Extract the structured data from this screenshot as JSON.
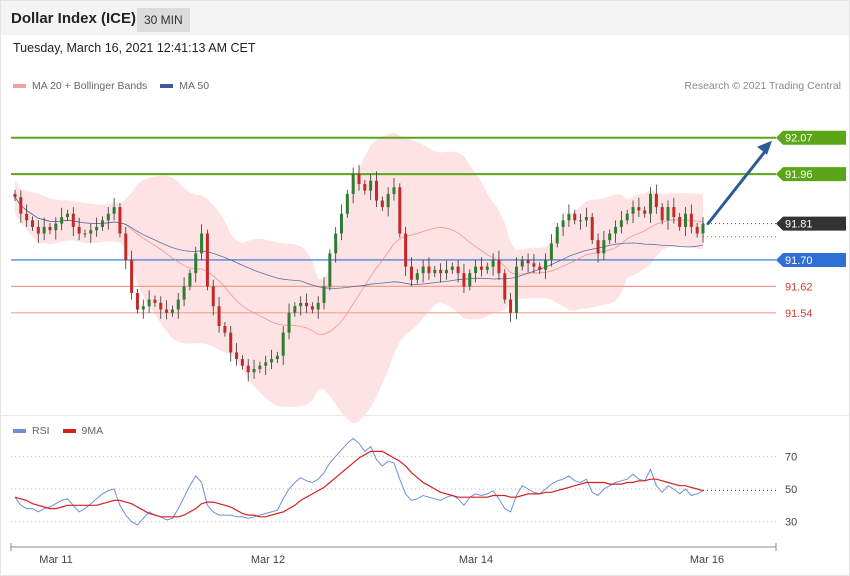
{
  "header": {
    "title": "Dollar Index (ICE)",
    "timeframe": "30 MIN",
    "datetime": "Tuesday, March 16, 2021 12:41:13 AM CET"
  },
  "colors": {
    "bollinger_fill": "#fde3e3",
    "ma20": "#f08080",
    "ma50": "#3d5a99",
    "resistance": "#5aa617",
    "support": "#f0a090",
    "pivot": "#2f6fd6",
    "current": "#333333",
    "arrow": "#2e5b97",
    "candle_up": "#2e7d32",
    "candle_down": "#c62828",
    "rsi": "#6f8fd8",
    "rsi_ma": "#d62020"
  },
  "legend": {
    "ma20": "MA 20 + Bollinger Bands",
    "ma50": "MA 50",
    "copyright": "Research © 2021 Trading Central"
  },
  "rsi_legend": {
    "rsi": "RSI",
    "ma": "9MA"
  },
  "chart_data": [
    {
      "type": "line",
      "chart": "price",
      "ylim": [
        91.27,
        92.16
      ],
      "x_ticks": [
        "Mar 11",
        "Mar 12",
        "Mar 14",
        "Mar 16"
      ],
      "levels": [
        {
          "value": 92.07,
          "label": "92.07",
          "kind": "resistance"
        },
        {
          "value": 91.96,
          "label": "91.96",
          "kind": "resistance"
        },
        {
          "value": 91.81,
          "label": "91.81",
          "kind": "current"
        },
        {
          "value": 91.7,
          "label": "91.70",
          "kind": "pivot"
        },
        {
          "value": 91.62,
          "label": "91.62",
          "kind": "support"
        },
        {
          "value": 91.54,
          "label": "91.54",
          "kind": "support"
        }
      ],
      "forecast_arrow": {
        "from": 91.81,
        "to": 92.07,
        "direction": "up"
      },
      "closes": [
        91.89,
        91.84,
        91.82,
        91.8,
        91.78,
        91.8,
        91.79,
        91.81,
        91.83,
        91.84,
        91.8,
        91.78,
        91.78,
        91.79,
        91.8,
        91.82,
        91.84,
        91.86,
        91.78,
        91.7,
        91.6,
        91.55,
        91.56,
        91.58,
        91.57,
        91.55,
        91.54,
        91.55,
        91.58,
        91.62,
        91.66,
        91.72,
        91.78,
        91.62,
        91.56,
        91.5,
        91.48,
        91.42,
        91.4,
        91.38,
        91.36,
        91.37,
        91.38,
        91.39,
        91.4,
        91.41,
        91.48,
        91.54,
        91.56,
        91.57,
        91.56,
        91.55,
        91.57,
        91.62,
        91.72,
        91.78,
        91.84,
        91.9,
        91.96,
        91.93,
        91.91,
        91.94,
        91.88,
        91.86,
        91.9,
        91.92,
        91.78,
        91.68,
        91.64,
        91.66,
        91.68,
        91.66,
        91.67,
        91.66,
        91.67,
        91.68,
        91.66,
        91.62,
        91.66,
        91.68,
        91.67,
        91.68,
        91.7,
        91.66,
        91.58,
        91.54,
        91.68,
        91.7,
        91.69,
        91.68,
        91.67,
        91.7,
        91.75,
        91.8,
        91.82,
        91.84,
        91.82,
        91.82,
        91.83,
        91.76,
        91.72,
        91.76,
        91.78,
        91.8,
        91.82,
        91.84,
        91.86,
        91.85,
        91.84,
        91.9,
        91.86,
        91.82,
        91.86,
        91.83,
        91.8,
        91.84,
        91.8,
        91.78,
        91.81
      ]
    },
    {
      "type": "line",
      "chart": "rsi",
      "ylim": [
        20,
        80
      ],
      "y_ticks": [
        30,
        50,
        70
      ],
      "series": [
        {
          "name": "RSI",
          "values": [
            45,
            40,
            38,
            38,
            36,
            38,
            39,
            41,
            43,
            44,
            40,
            36,
            38,
            41,
            44,
            47,
            49,
            50,
            40,
            34,
            30,
            28,
            32,
            36,
            34,
            33,
            31,
            32,
            38,
            45,
            52,
            58,
            54,
            40,
            36,
            34,
            34,
            34,
            33,
            33,
            32,
            33,
            34,
            35,
            36,
            37,
            44,
            50,
            54,
            57,
            55,
            54,
            56,
            60,
            66,
            70,
            74,
            78,
            81,
            78,
            73,
            76,
            68,
            64,
            67,
            66,
            56,
            47,
            43,
            44,
            46,
            45,
            44,
            43,
            45,
            46,
            44,
            40,
            45,
            47,
            46,
            47,
            49,
            44,
            38,
            36,
            46,
            52,
            50,
            48,
            47,
            50,
            53,
            55,
            56,
            58,
            55,
            54,
            56,
            48,
            46,
            50,
            52,
            54,
            55,
            56,
            59,
            56,
            55,
            62,
            52,
            48,
            52,
            50,
            47,
            50,
            46,
            47,
            49
          ]
        },
        {
          "name": "9MA",
          "values": [
            45,
            44,
            43,
            41,
            40,
            39,
            38,
            38,
            39,
            40,
            40,
            40,
            40,
            40,
            40,
            41,
            42,
            43,
            43,
            42,
            41,
            39,
            37,
            35,
            34,
            33,
            33,
            33,
            33,
            34,
            36,
            38,
            41,
            42,
            42,
            41,
            40,
            39,
            37,
            35,
            34,
            34,
            33,
            33,
            34,
            35,
            36,
            38,
            40,
            43,
            45,
            47,
            49,
            51,
            54,
            57,
            60,
            63,
            66,
            69,
            71,
            73,
            73,
            73,
            71,
            69,
            67,
            64,
            60,
            57,
            54,
            52,
            50,
            48,
            47,
            46,
            45,
            45,
            45,
            45,
            45,
            45,
            46,
            46,
            46,
            45,
            45,
            46,
            47,
            47,
            47,
            48,
            48,
            49,
            50,
            51,
            52,
            53,
            54,
            54,
            54,
            54,
            53,
            53,
            53,
            54,
            54,
            55,
            55,
            56,
            56,
            55,
            54,
            53,
            52,
            52,
            51,
            50,
            49
          ]
        }
      ]
    }
  ]
}
